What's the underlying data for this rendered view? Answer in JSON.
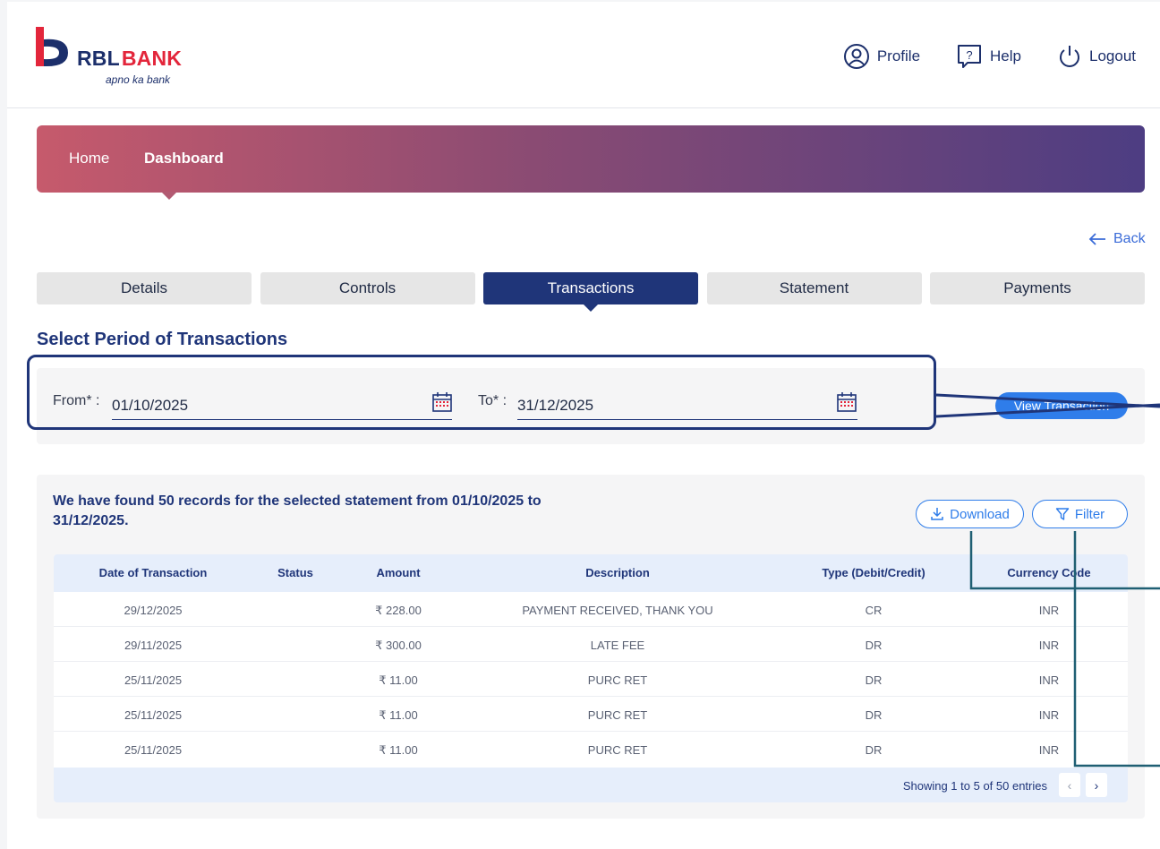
{
  "header": {
    "logo_rbl": "RBL",
    "logo_bank": "BANK",
    "logo_tagline": "apno ka bank",
    "nav": {
      "profile": "Profile",
      "help": "Help",
      "logout": "Logout"
    }
  },
  "breadcrumb": {
    "home": "Home",
    "dashboard": "Dashboard"
  },
  "back_label": "Back",
  "tabs": [
    {
      "label": "Details"
    },
    {
      "label": "Controls"
    },
    {
      "label": "Transactions"
    },
    {
      "label": "Statement"
    },
    {
      "label": "Payments"
    }
  ],
  "active_tab": "Transactions",
  "period": {
    "title": "Select Period of Transactions",
    "from_label": "From* :",
    "from_value": "01/10/2025",
    "to_label": "To* :",
    "to_value": "31/12/2025",
    "view_button": "View Transaction"
  },
  "results": {
    "summary": "We have found 50 records for the selected statement from 01/10/2025 to 31/12/2025.",
    "download_label": "Download",
    "filter_label": "Filter",
    "columns": [
      "Date of Transaction",
      "Status",
      "Amount",
      "Description",
      "Type (Debit/Credit)",
      "Currency Code"
    ],
    "rows": [
      [
        "29/12/2025",
        "",
        "₹ 228.00",
        "PAYMENT RECEIVED, THANK YOU",
        "CR",
        "INR"
      ],
      [
        "29/11/2025",
        "",
        "₹ 300.00",
        "LATE FEE",
        "DR",
        "INR"
      ],
      [
        "25/11/2025",
        "",
        "₹ 11.00",
        "PURC RET",
        "DR",
        "INR"
      ],
      [
        "25/11/2025",
        "",
        "₹ 11.00",
        "PURC RET",
        "DR",
        "INR"
      ],
      [
        "25/11/2025",
        "",
        "₹ 11.00",
        "PURC RET",
        "DR",
        "INR"
      ]
    ],
    "pager_text": "Showing 1 to 5 of 50 entries",
    "pager_prev": "‹",
    "pager_next": "›"
  },
  "colors": {
    "brand_navy": "#1f3579",
    "brand_red": "#e3263b",
    "accent_blue": "#2f7dea"
  }
}
